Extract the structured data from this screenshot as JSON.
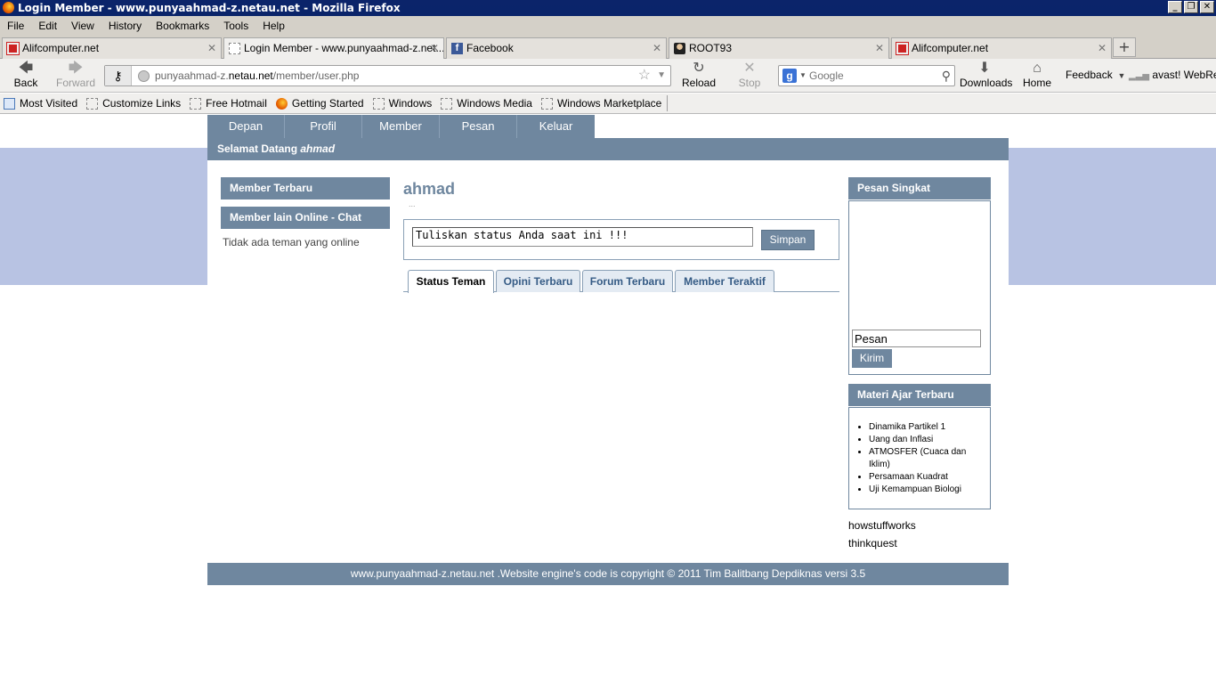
{
  "window": {
    "title": "Login Member - www.punyaahmad-z.netau.net - Mozilla Firefox",
    "buttons": [
      "_",
      "❐",
      "✕"
    ]
  },
  "menu": [
    "File",
    "Edit",
    "View",
    "History",
    "Bookmarks",
    "Tools",
    "Help"
  ],
  "tabs": [
    {
      "label": "Alifcomputer.net",
      "icon": "alifcomputer-favicon"
    },
    {
      "label": "Login Member - www.punyaahmad-z.net...",
      "icon": "blank-page-favicon"
    },
    {
      "label": "Facebook",
      "icon": "facebook-favicon"
    },
    {
      "label": "ROOT93",
      "icon": "root93-favicon"
    },
    {
      "label": "Alifcomputer.net",
      "icon": "alifcomputer-favicon"
    }
  ],
  "new_tab": "+",
  "nav": {
    "back": "Back",
    "forward": "Forward",
    "reload": "Reload",
    "stop": "Stop",
    "downloads": "Downloads",
    "home": "Home",
    "feedback": "Feedback",
    "avast": "avast! WebRep"
  },
  "url": {
    "prefix": "punyaahmad-z.",
    "domain": "netau.net",
    "path": "/member/user.php"
  },
  "search": {
    "placeholder": "Google"
  },
  "bookmarks": [
    "Most Visited",
    "Customize Links",
    "Free Hotmail",
    "Getting Started",
    "Windows",
    "Windows Media",
    "Windows Marketplace"
  ],
  "site": {
    "topnav": [
      "Depan",
      "Profil",
      "Member",
      "Pesan",
      "Keluar"
    ],
    "welcome_prefix": "Selamat Datang ",
    "welcome_user": "ahmad",
    "left": {
      "member_terbaru": "Member Terbaru",
      "member_online": "Member lain Online - Chat",
      "no_friends": "Tidak ada teman yang online"
    },
    "center": {
      "username": "ahmad",
      "dots": "...",
      "status_text": "Tuliskan status Anda saat ini !!!",
      "simpan": "Simpan",
      "tabs": [
        "Status Teman",
        "Opini Terbaru",
        "Forum Terbaru",
        "Member Teraktif"
      ]
    },
    "right": {
      "pesan_singkat": "Pesan Singkat",
      "pesan_value": "Pesan",
      "kirim": "Kirim",
      "materi_title": "Materi Ajar Terbaru",
      "materi": [
        "Dinamika Partikel 1",
        "Uang dan Inflasi",
        "ATMOSFER (Cuaca dan Iklim)",
        "Persamaan Kuadrat",
        "Uji Kemampuan Biologi"
      ],
      "links": [
        "howstuffworks",
        "thinkquest"
      ]
    },
    "footer": "www.punyaahmad-z.netau.net .Website engine's code is copyright © 2011 Tim Balitbang Depdiknas versi 3.5"
  },
  "colors": {
    "header_blue": "#6f879f",
    "band": "#b8c3e3",
    "titlebar": "#0a246a"
  }
}
